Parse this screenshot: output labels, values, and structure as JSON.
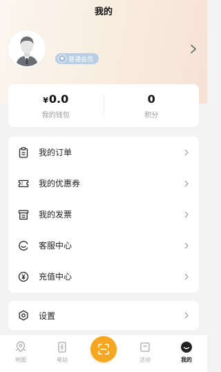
{
  "header": {
    "title": "我的",
    "avatar_icon": "default-user-avatar-icon",
    "member_badge": "普通会员",
    "badge_icon": "diamond-icon",
    "colors": {
      "badge_bg": "#b9cfe4",
      "accent": "#f5a623"
    }
  },
  "wallet": {
    "balance_currency": "¥",
    "balance_value": "0.0",
    "balance_label": "我的钱包",
    "points_value": "0",
    "points_label": "积分"
  },
  "menu": {
    "items": [
      {
        "label": "我的订单",
        "icon": "clipboard-icon"
      },
      {
        "label": "我的优惠券",
        "icon": "ticket-icon"
      },
      {
        "label": "我的发票",
        "icon": "invoice-icon"
      },
      {
        "label": "客服中心",
        "icon": "customer-service-icon"
      },
      {
        "label": "充值中心",
        "icon": "yuan-coin-icon"
      }
    ]
  },
  "settings": {
    "label": "设置",
    "icon": "gear-icon"
  },
  "tabbar": {
    "tabs": [
      {
        "label": "地图",
        "icon": "map-pin-icon",
        "active": false
      },
      {
        "label": "电站",
        "icon": "charging-station-icon",
        "active": false
      },
      {
        "label": "",
        "icon": "scan-icon",
        "active": false
      },
      {
        "label": "活动",
        "icon": "shopping-bag-icon",
        "active": false
      },
      {
        "label": "我的",
        "icon": "profile-icon",
        "active": true
      }
    ]
  }
}
